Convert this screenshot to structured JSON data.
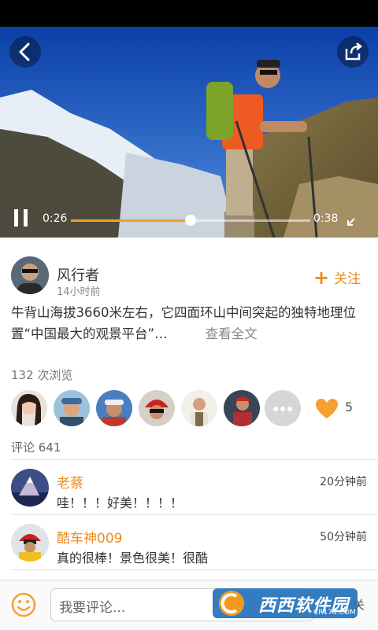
{
  "video": {
    "current_time": "0:26",
    "total_time": "0:38",
    "progress": 0.5
  },
  "author": {
    "name": "风行者",
    "time": "14小时前",
    "follow_label": "关注"
  },
  "post": {
    "description": "牛背山海拔3660米左右，它四面环山中间突起的独特地理位置“中国最大的观景平台”…",
    "more_label": "查看全文"
  },
  "stats": {
    "views": "132 次浏览",
    "like_count": "5"
  },
  "comments": {
    "header": "评论  641",
    "items": [
      {
        "name": "老蔡",
        "time": "20分钟前",
        "text": "哇！！！好美！！！！"
      },
      {
        "name": "酷车神009",
        "time": "50分钟前",
        "text": "真的很棒！景色很美！很酷"
      }
    ]
  },
  "input": {
    "placeholder": "我要评论...",
    "send_label": "关"
  },
  "watermark": {
    "brand": "西西软件园",
    "sub": "CR173.COM"
  },
  "colors": {
    "accent": "#f08c1a",
    "progress": "#f0a020"
  },
  "icons": [
    "back-arrow-icon",
    "share-icon",
    "pause-icon",
    "fullscreen-icon",
    "plus-icon",
    "ellipsis-icon",
    "heart-icon",
    "smiley-icon"
  ]
}
